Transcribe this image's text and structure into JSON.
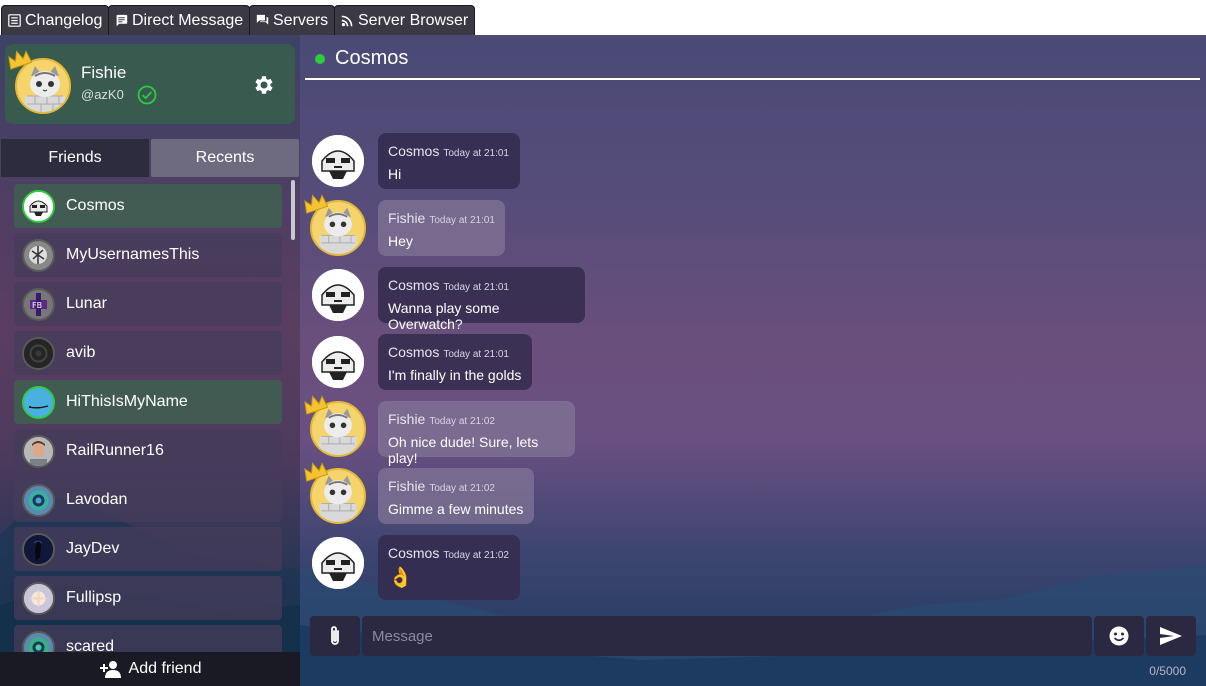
{
  "tabs": [
    {
      "label": "Changelog",
      "icon": "list-icon"
    },
    {
      "label": "Direct Message",
      "icon": "message-icon"
    },
    {
      "label": "Servers",
      "icon": "chat-icon"
    },
    {
      "label": "Server Browser",
      "icon": "rss-icon"
    }
  ],
  "profile": {
    "name": "Fishie",
    "handle": "@azK0"
  },
  "segments": {
    "friends": "Friends",
    "recents": "Recents"
  },
  "friends": [
    {
      "name": "Cosmos",
      "online": true
    },
    {
      "name": "MyUsernamesThis",
      "online": false
    },
    {
      "name": "Lunar",
      "online": false
    },
    {
      "name": "avib",
      "online": false
    },
    {
      "name": "HiThisIsMyName",
      "online": true
    },
    {
      "name": "RailRunner16",
      "online": false
    },
    {
      "name": "Lavodan",
      "online": false
    },
    {
      "name": "JayDev",
      "online": false
    },
    {
      "name": "Fullipsp",
      "online": false
    },
    {
      "name": "scared",
      "online": false
    }
  ],
  "add_friend": "Add friend",
  "chat": {
    "title": "Cosmos",
    "messages": [
      {
        "author": "Cosmos",
        "time": "Today at 21:01",
        "text": "Hi"
      },
      {
        "author": "Fishie",
        "time": "Today at 21:01",
        "text": "Hey"
      },
      {
        "author": "Cosmos",
        "time": "Today at 21:01",
        "text": "Wanna play some Overwatch?"
      },
      {
        "author": "Cosmos",
        "time": "Today at 21:01",
        "text": "I'm finally in the golds"
      },
      {
        "author": "Fishie",
        "time": "Today at 21:02",
        "text": "Oh nice dude! Sure, lets play!"
      },
      {
        "author": "Fishie",
        "time": "Today at 21:02",
        "text": "Gimme a few minutes"
      },
      {
        "author": "Cosmos",
        "time": "Today at 21:02",
        "text": "👌"
      }
    ]
  },
  "composer": {
    "placeholder": "Message",
    "counter": "0/5000"
  },
  "colors": {
    "online": "#2ecc40",
    "tab_bg": "#3a3944"
  }
}
